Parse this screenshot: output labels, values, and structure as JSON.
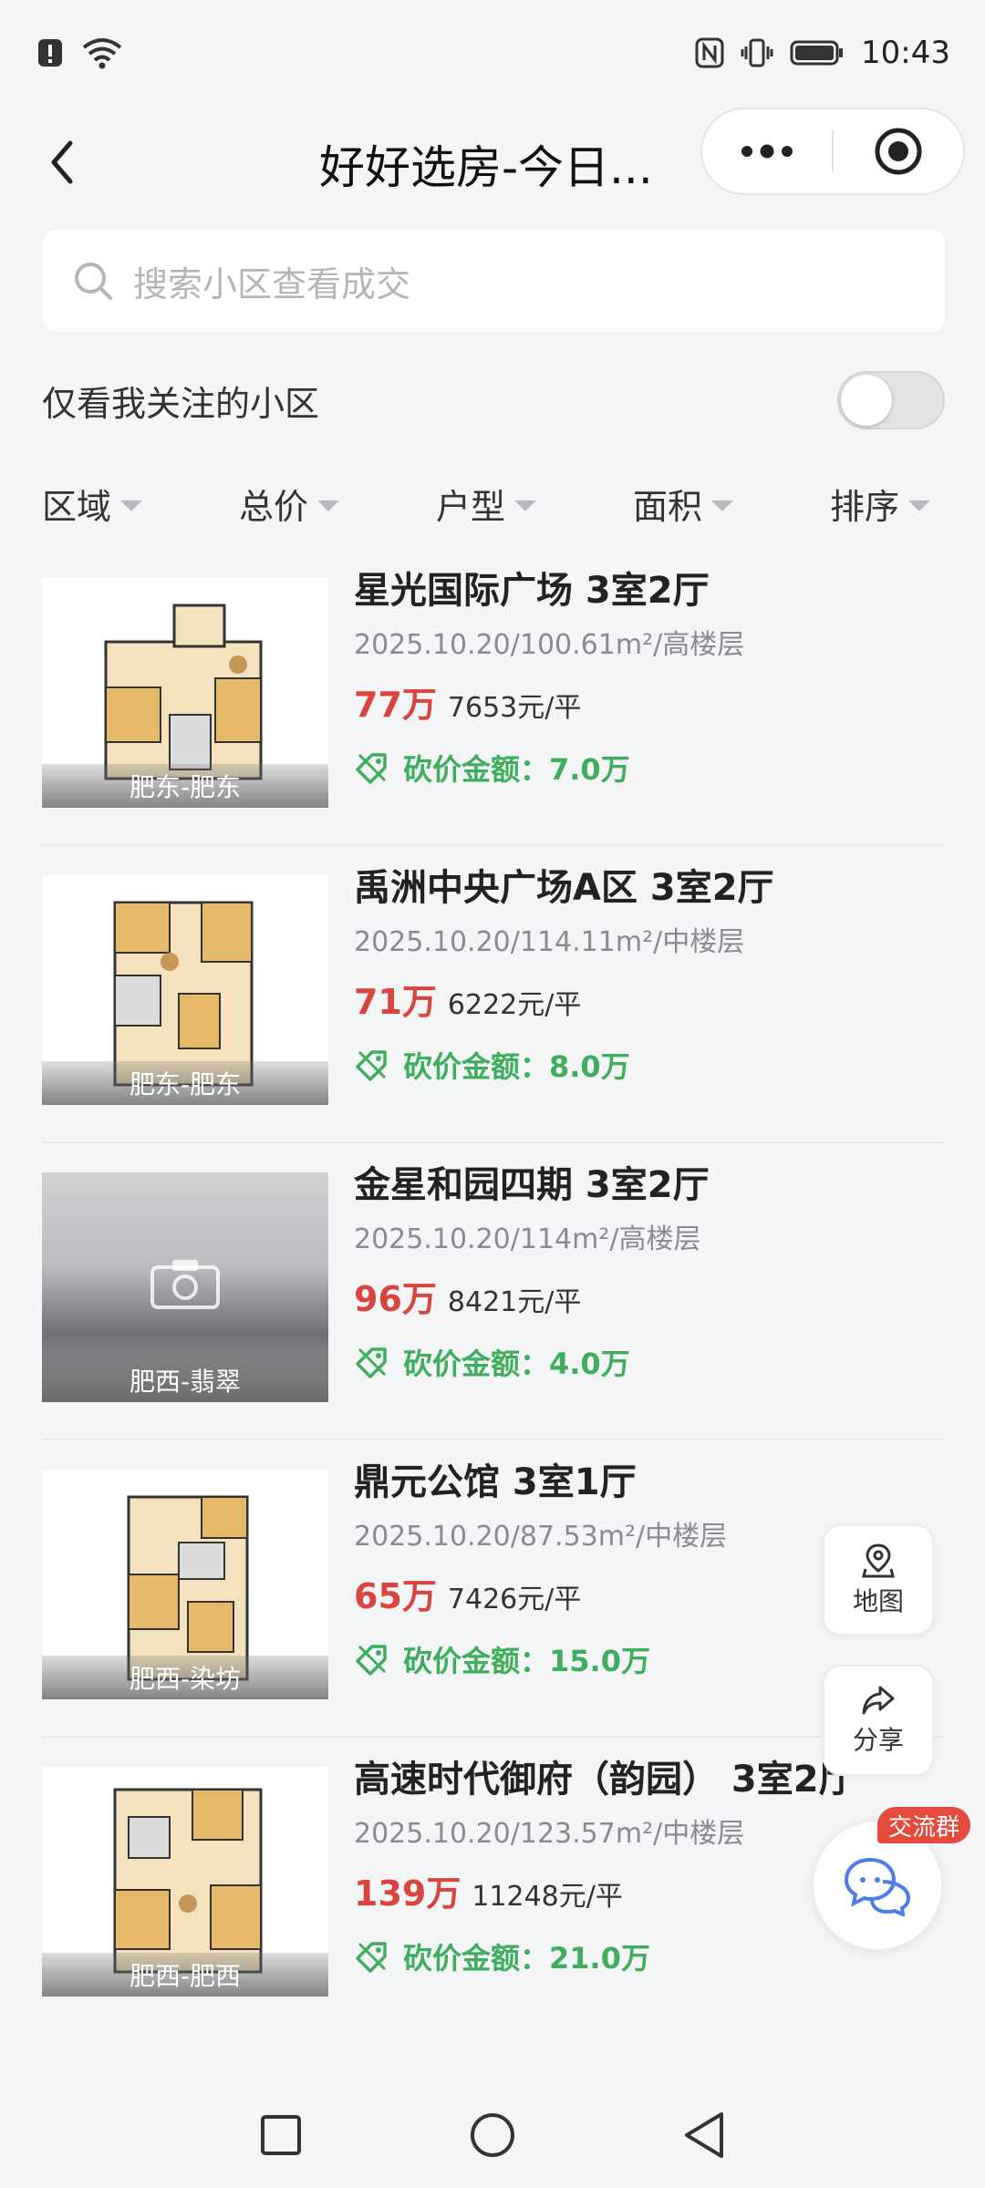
{
  "status_bar": {
    "time": "10:43",
    "left_icons": [
      "alert-icon",
      "wifi-icon"
    ],
    "right_icons": [
      "nfc-icon",
      "vibrate-icon",
      "battery-icon"
    ]
  },
  "nav": {
    "title": "好好选房-今日...",
    "back_icon": "chevron-left-icon",
    "more_icon": "more-dots-icon",
    "close_icon": "target-icon"
  },
  "search": {
    "placeholder": "搜索小区查看成交"
  },
  "follow_filter": {
    "label": "仅看我关注的小区",
    "enabled": false
  },
  "filters": [
    {
      "label": "区域"
    },
    {
      "label": "总价"
    },
    {
      "label": "户型"
    },
    {
      "label": "面积"
    },
    {
      "label": "排序"
    }
  ],
  "listings": [
    {
      "title": "星光国际广场 3室2厅",
      "meta": "2025.10.20/100.61m²/高楼层",
      "total_price": "77万",
      "unit_price": "7653元/平",
      "discount": "砍价金额：7.0万",
      "area_label": "肥东-肥东",
      "has_floorplan": true
    },
    {
      "title": "禹洲中央广场A区 3室2厅",
      "meta": "2025.10.20/114.11m²/中楼层",
      "total_price": "71万",
      "unit_price": "6222元/平",
      "discount": "砍价金额：8.0万",
      "area_label": "肥东-肥东",
      "has_floorplan": true
    },
    {
      "title": "金星和园四期 3室2厅",
      "meta": "2025.10.20/114m²/高楼层",
      "total_price": "96万",
      "unit_price": "8421元/平",
      "discount": "砍价金额：4.0万",
      "area_label": "肥西-翡翠",
      "has_floorplan": false
    },
    {
      "title": "鼎元公馆 3室1厅",
      "meta": "2025.10.20/87.53m²/中楼层",
      "total_price": "65万",
      "unit_price": "7426元/平",
      "discount": "砍价金额：15.0万",
      "area_label": "肥西-染坊",
      "has_floorplan": true
    },
    {
      "title": "高速时代御府（韵园） 3室2厅",
      "meta": "2025.10.20/123.57m²/中楼层",
      "total_price": "139万",
      "unit_price": "11248元/平",
      "discount": "砍价金额：21.0万",
      "area_label": "肥西-肥西",
      "has_floorplan": true
    }
  ],
  "floating": {
    "map_label": "地图",
    "share_label": "分享",
    "chat_badge": "交流群"
  },
  "colors": {
    "price_red": "#d9443c",
    "discount_green": "#3fae5c",
    "chat_blue": "#4a7de6"
  }
}
